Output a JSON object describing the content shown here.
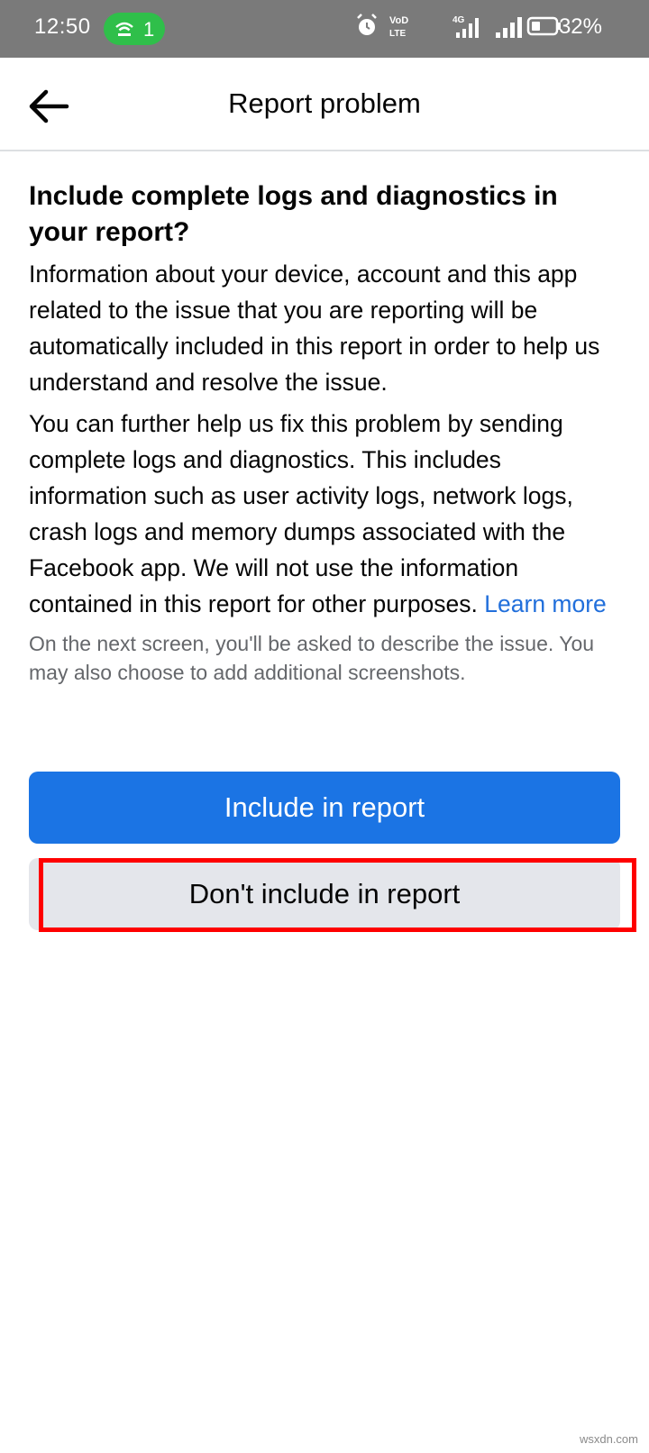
{
  "status_bar": {
    "time": "12:50",
    "hotspot_count": "1",
    "battery_percent": "32%",
    "icons": [
      "hotspot-icon",
      "alarm-icon",
      "volte-icon",
      "signal-4g-icon",
      "signal-icon",
      "battery-icon"
    ],
    "background_color": "#7a7a7a",
    "hotspot_color": "#2fbf4a"
  },
  "header": {
    "title": "Report problem",
    "back_icon": "back-arrow-icon"
  },
  "content": {
    "question": "Include complete logs and diagnostics in your report?",
    "paragraph_1": "Information about your device, account and this app related to the issue that you are reporting will be automatically included in this report in order to help us understand and resolve the issue.",
    "paragraph_2": "You can further help us fix this problem by sending complete logs and diagnostics. This includes information such as user activity logs, network logs, crash logs and memory dumps associated with the Facebook app. We will not use the information contained in this report for other purposes.",
    "learn_more": "Learn more",
    "note": "On the next screen, you'll be asked to describe the issue. You may also choose to add additional screenshots."
  },
  "actions": {
    "include_label": "Include in report",
    "dont_include_label": "Don't include in report",
    "primary_color": "#1b74e4",
    "secondary_color": "#e4e6eb",
    "highlight_color": "#ff0000"
  },
  "watermark": "wsxdn.com"
}
